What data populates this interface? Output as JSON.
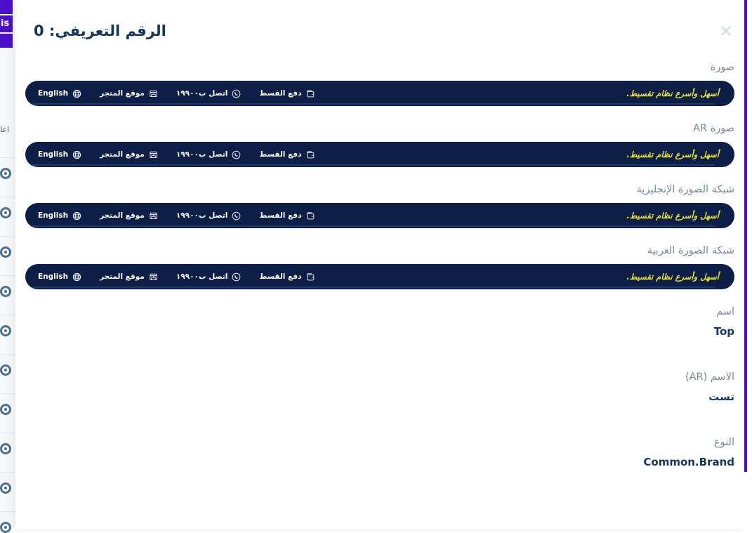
{
  "modal": {
    "title": "الرقم التعريفي: 0",
    "close_label": "×",
    "close_icon": "close-icon"
  },
  "banner": {
    "tagline": "أسهل وأسرع نظام تقسيط.",
    "links": [
      {
        "label": "دفع القسط",
        "icon": "wallet-icon",
        "ltr": false
      },
      {
        "label": "اتصل ب١٩٩٠٠",
        "icon": "phone-icon",
        "ltr": false
      },
      {
        "label": "موقع المتجر",
        "icon": "store-icon",
        "ltr": false
      },
      {
        "label": "English",
        "icon": "globe-icon",
        "ltr": true
      }
    ]
  },
  "fields": [
    {
      "label": "صورة",
      "type": "image"
    },
    {
      "label": "صورة AR",
      "type": "image"
    },
    {
      "label": "شبكة الصورة الإنجليزية",
      "type": "image"
    },
    {
      "label": "شبكة الصورة العربية",
      "type": "image"
    },
    {
      "label": "اسم",
      "value": "Top",
      "type": "text",
      "ltr": true
    },
    {
      "label": "الاسم (AR)",
      "value": "تست",
      "type": "text",
      "ltr": false
    },
    {
      "label": "النوع",
      "value": "Common.Brand",
      "type": "text",
      "ltr": true
    }
  ],
  "background": {
    "clipped_header_text": "is",
    "clipped_list_text": "اعا",
    "row_icon": "circle-target-icon"
  },
  "colors": {
    "banner_bg": "#0d1f47",
    "banner_accent": "#e4e03a",
    "title": "#14365c",
    "label": "#76889b",
    "scrollbar": "#4b10c8",
    "purple": "#4b10c8"
  }
}
